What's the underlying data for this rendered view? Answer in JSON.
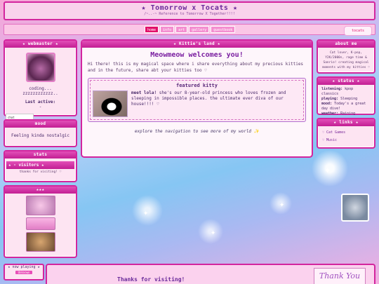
{
  "header": {
    "title": "★ Tomorrow x Tocats ★",
    "subtitle": "/~..-~ Reference to Tomorrow X Together!!!!"
  },
  "nav": {
    "items": [
      "home",
      "info",
      "art",
      "gallery",
      "guestbook"
    ],
    "badge": "tocats"
  },
  "webmaster": {
    "title": "★ webmaster ★",
    "status": "coding...",
    "zzz": "zzzzzzzzzzzz..",
    "last_active_label": "Last active:",
    "last_active_value": "-",
    "chat_label": "chat"
  },
  "mood": {
    "title": "mood",
    "text": "Feeling kinda nostalgic"
  },
  "stats": {
    "title": "stats",
    "visitors_label": "★ - visitors ★",
    "thanks": "thanks for visiting! ♡"
  },
  "stamps": {
    "title": "★★★"
  },
  "welcome": {
    "header": "★ Kittie's land ★",
    "title": "Meowmeow welcomes you!",
    "intro": "Hi there! this is my magical space where i share everything about my precious kitties and in the future, share abt your kitties too ♡",
    "featured_title": "featured kitty",
    "featured_name": "meet lola!",
    "featured_text": " she's our 8-year-old princess who loves frozen and sleeping in impossible places. the ultimate ever diva of our house!!!! ♡",
    "explore": "explore the navigation to see more of my world ✨"
  },
  "about": {
    "title": "about me",
    "text": "Cat lover, K-pop, Y2K/2000s, rage time & Sanrio! creating magical moments with my kitties ♡"
  },
  "status": {
    "title": "★ status ★",
    "lines": [
      {
        "label": "listening:",
        "value": " kpop classics"
      },
      {
        "label": "playing:",
        "value": " Sleeping"
      },
      {
        "label": "mood:",
        "value": " Today's a great day dive!"
      },
      {
        "label": "weather:",
        "value": " Raining"
      }
    ]
  },
  "links": {
    "title": "★ links ★",
    "items": [
      "♡ Cat Games",
      "♡ Music"
    ]
  },
  "music": {
    "label": "★ now playing ★",
    "button": "Unknown"
  },
  "footer": {
    "text": "Thanks for visiting!",
    "thank_you": "Thank You"
  }
}
